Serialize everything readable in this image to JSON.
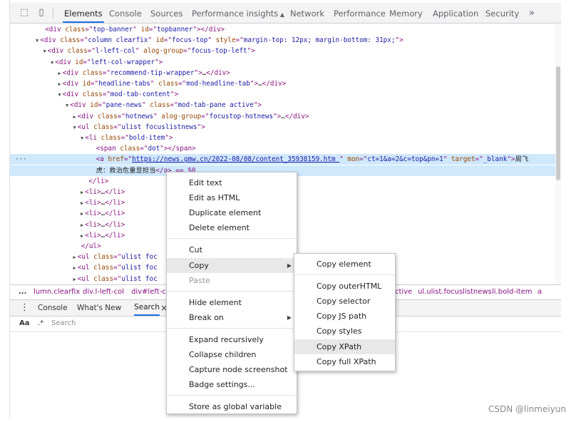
{
  "tabs": [
    "Elements",
    "Console",
    "Sources",
    "Performance insights",
    "Network",
    "Performance",
    "Memory",
    "Application",
    "Security",
    "»"
  ],
  "performance_insights_icon": "flask-icon",
  "code_lines": [
    {
      "indent": 0,
      "tri": "",
      "parts": [
        [
          "tx",
          "  "
        ],
        [
          "t",
          "<div "
        ],
        [
          "a",
          "class"
        ],
        [
          "t",
          "=\""
        ],
        [
          "v",
          "top-banner"
        ],
        [
          "t",
          "\" "
        ],
        [
          "a",
          "id"
        ],
        [
          "t",
          "=\""
        ],
        [
          "v",
          "topbanner"
        ],
        [
          "t",
          "\"></div>"
        ]
      ]
    },
    {
      "indent": 0,
      "tri": "▼",
      "parts": [
        [
          "t",
          "<div "
        ],
        [
          "a",
          "class"
        ],
        [
          "t",
          "=\""
        ],
        [
          "v",
          "column clearfix"
        ],
        [
          "t",
          "\" "
        ],
        [
          "a",
          "id"
        ],
        [
          "t",
          "=\""
        ],
        [
          "v",
          "focus-top"
        ],
        [
          "t",
          "\" "
        ],
        [
          "a",
          "style"
        ],
        [
          "t",
          "=\""
        ],
        [
          "v",
          "margin-top: 12px; margin-bottom: 31px;"
        ],
        [
          "t",
          "\">"
        ]
      ]
    },
    {
      "indent": 1,
      "tri": "▼",
      "parts": [
        [
          "t",
          "<div "
        ],
        [
          "a",
          "class"
        ],
        [
          "t",
          "=\""
        ],
        [
          "v",
          "l-left-col"
        ],
        [
          "t",
          "\" "
        ],
        [
          "a",
          "alog-group"
        ],
        [
          "t",
          "=\""
        ],
        [
          "v",
          "focus-top-left"
        ],
        [
          "t",
          "\">"
        ]
      ]
    },
    {
      "indent": 2,
      "tri": "▼",
      "parts": [
        [
          "t",
          "<div "
        ],
        [
          "a",
          "id"
        ],
        [
          "t",
          "=\""
        ],
        [
          "v",
          "left-col-wrapper"
        ],
        [
          "t",
          "\">"
        ]
      ]
    },
    {
      "indent": 3,
      "tri": "▶",
      "parts": [
        [
          "t",
          "<div "
        ],
        [
          "a",
          "class"
        ],
        [
          "t",
          "=\""
        ],
        [
          "v",
          "recommend-tip-wrapper"
        ],
        [
          "t",
          "\">"
        ],
        [
          "tx",
          "…"
        ],
        [
          "t",
          "</div>"
        ]
      ]
    },
    {
      "indent": 3,
      "tri": "▶",
      "parts": [
        [
          "t",
          "<div "
        ],
        [
          "a",
          "id"
        ],
        [
          "t",
          "=\""
        ],
        [
          "v",
          "headline-tabs"
        ],
        [
          "t",
          "\" "
        ],
        [
          "a",
          "class"
        ],
        [
          "t",
          "=\""
        ],
        [
          "v",
          "mod-headline-tab"
        ],
        [
          "t",
          "\">"
        ],
        [
          "tx",
          "…"
        ],
        [
          "t",
          "</div>"
        ]
      ]
    },
    {
      "indent": 3,
      "tri": "▼",
      "parts": [
        [
          "t",
          "<div "
        ],
        [
          "a",
          "class"
        ],
        [
          "t",
          "=\""
        ],
        [
          "v",
          "mod-tab-content"
        ],
        [
          "t",
          "\">"
        ]
      ]
    },
    {
      "indent": 4,
      "tri": "▼",
      "parts": [
        [
          "t",
          "<div "
        ],
        [
          "a",
          "id"
        ],
        [
          "t",
          "=\""
        ],
        [
          "v",
          "pane-news"
        ],
        [
          "t",
          "\" "
        ],
        [
          "a",
          "class"
        ],
        [
          "t",
          "=\""
        ],
        [
          "v",
          "mod-tab-pane active"
        ],
        [
          "t",
          "\">"
        ]
      ]
    },
    {
      "indent": 5,
      "tri": "▶",
      "parts": [
        [
          "t",
          "<div "
        ],
        [
          "a",
          "class"
        ],
        [
          "t",
          "=\""
        ],
        [
          "v",
          "hotnews"
        ],
        [
          "t",
          "\" "
        ],
        [
          "a",
          "alog-group"
        ],
        [
          "t",
          "=\""
        ],
        [
          "v",
          "focustop-hotnews"
        ],
        [
          "t",
          "\">"
        ],
        [
          "tx",
          "…"
        ],
        [
          "t",
          "</div>"
        ]
      ]
    },
    {
      "indent": 5,
      "tri": "▼",
      "parts": [
        [
          "t",
          "<ul "
        ],
        [
          "a",
          "class"
        ],
        [
          "t",
          "=\""
        ],
        [
          "v",
          "ulist focuslistnews"
        ],
        [
          "t",
          "\">"
        ]
      ]
    },
    {
      "indent": 6,
      "tri": "▼",
      "parts": [
        [
          "t",
          "<li "
        ],
        [
          "a",
          "class"
        ],
        [
          "t",
          "=\""
        ],
        [
          "v",
          "bold-item"
        ],
        [
          "t",
          "\">"
        ]
      ]
    },
    {
      "indent": 7,
      "tri": "",
      "parts": [
        [
          "t",
          "<span "
        ],
        [
          "a",
          "class"
        ],
        [
          "t",
          "=\""
        ],
        [
          "v",
          "dot"
        ],
        [
          "t",
          "\"></span>"
        ]
      ]
    },
    {
      "indent": 7,
      "tri": "",
      "sel": true,
      "parts": [
        [
          "t",
          "<a "
        ],
        [
          "a",
          "href"
        ],
        [
          "t",
          "=\""
        ],
        [
          "u",
          "https://news.gmw.cn/2022-08/08/content_35938159.htm "
        ],
        [
          "t",
          "\" "
        ],
        [
          "a",
          "mon"
        ],
        [
          "t",
          "=\""
        ],
        [
          "v",
          "ct=1&a=2&c=top&pn=1"
        ],
        [
          "t",
          "\" "
        ],
        [
          "a",
          "target"
        ],
        [
          "t",
          "=\""
        ],
        [
          "v",
          "_blank"
        ],
        [
          "t",
          "\">"
        ],
        [
          "tx",
          "周飞"
        ]
      ]
    },
    {
      "indent": 7,
      "tri": "",
      "sel": true,
      "parts": [
        [
          "tx",
          "虎：救治危重显担当"
        ],
        [
          "t",
          "</a> == $0"
        ]
      ]
    },
    {
      "indent": 6,
      "tri": "",
      "parts": [
        [
          "t",
          "</li>"
        ]
      ]
    },
    {
      "indent": 6,
      "tri": "▶",
      "parts": [
        [
          "t",
          "<li>"
        ],
        [
          "tx",
          "…"
        ],
        [
          "t",
          "</li>"
        ]
      ]
    },
    {
      "indent": 6,
      "tri": "▶",
      "parts": [
        [
          "t",
          "<li>"
        ],
        [
          "tx",
          "…"
        ],
        [
          "t",
          "</li>"
        ]
      ]
    },
    {
      "indent": 6,
      "tri": "▶",
      "parts": [
        [
          "t",
          "<li>"
        ],
        [
          "tx",
          "…"
        ],
        [
          "t",
          "</li>"
        ]
      ]
    },
    {
      "indent": 6,
      "tri": "▶",
      "parts": [
        [
          "t",
          "<li>"
        ],
        [
          "tx",
          "…"
        ],
        [
          "t",
          "</li>"
        ]
      ]
    },
    {
      "indent": 6,
      "tri": "▶",
      "parts": [
        [
          "t",
          "<li>"
        ],
        [
          "tx",
          "…"
        ],
        [
          "t",
          "</li>"
        ]
      ]
    },
    {
      "indent": 5,
      "tri": "",
      "parts": [
        [
          "t",
          "</ul>"
        ]
      ]
    },
    {
      "indent": 5,
      "tri": "▶",
      "parts": [
        [
          "t",
          "<ul "
        ],
        [
          "a",
          "class"
        ],
        [
          "t",
          "=\""
        ],
        [
          "v",
          "ulist foc"
        ]
      ]
    },
    {
      "indent": 5,
      "tri": "▶",
      "parts": [
        [
          "t",
          "<ul "
        ],
        [
          "a",
          "class"
        ],
        [
          "t",
          "=\""
        ],
        [
          "v",
          "ulist foc"
        ]
      ]
    },
    {
      "indent": 5,
      "tri": "▶",
      "parts": [
        [
          "t",
          "<ul "
        ],
        [
          "a",
          "class"
        ],
        [
          "t",
          "=\""
        ],
        [
          "v",
          "ulist foc"
        ]
      ]
    }
  ],
  "selected_dots": "···",
  "breadcrumbs": {
    "dots": "...",
    "items": [
      "lumn.clearfix",
      "div.l-left-col",
      "div#left-c",
      "ctive",
      "ul.ulist.focuslistnews",
      "li.bold-item",
      "a"
    ]
  },
  "drawer": {
    "menu_icon": "kebab-icon",
    "tabs": [
      "Console",
      "What's New",
      "Search"
    ],
    "close": "×"
  },
  "search": {
    "case_label": "Aa",
    "regex_label": ".*",
    "placeholder": "Search"
  },
  "context_menu": {
    "items": [
      {
        "label": "Edit text"
      },
      {
        "label": "Edit as HTML"
      },
      {
        "label": "Duplicate element"
      },
      {
        "label": "Delete element"
      },
      {
        "sep": true
      },
      {
        "label": "Cut"
      },
      {
        "label": "Copy",
        "sub": true,
        "hl": true
      },
      {
        "label": "Paste",
        "dis": true
      },
      {
        "sep": true
      },
      {
        "label": "Hide element"
      },
      {
        "label": "Break on",
        "sub": true
      },
      {
        "sep": true
      },
      {
        "label": "Expand recursively"
      },
      {
        "label": "Collapse children"
      },
      {
        "label": "Capture node screenshot"
      },
      {
        "label": "Badge settings..."
      },
      {
        "sep": true
      },
      {
        "label": "Store as global variable"
      }
    ]
  },
  "copy_submenu": {
    "items": [
      {
        "label": "Copy element"
      },
      {
        "sep": true
      },
      {
        "label": "Copy outerHTML"
      },
      {
        "label": "Copy selector"
      },
      {
        "label": "Copy JS path"
      },
      {
        "label": "Copy styles"
      },
      {
        "label": "Copy XPath",
        "hl": true
      },
      {
        "label": "Copy full XPath"
      }
    ]
  },
  "watermark": "CSDN @linmeiyun",
  "colors": {
    "accent": "#1a73e8",
    "selection": "#cfe8fc",
    "tag": "#881280",
    "attr": "#994500",
    "value": "#1a1aa6"
  }
}
